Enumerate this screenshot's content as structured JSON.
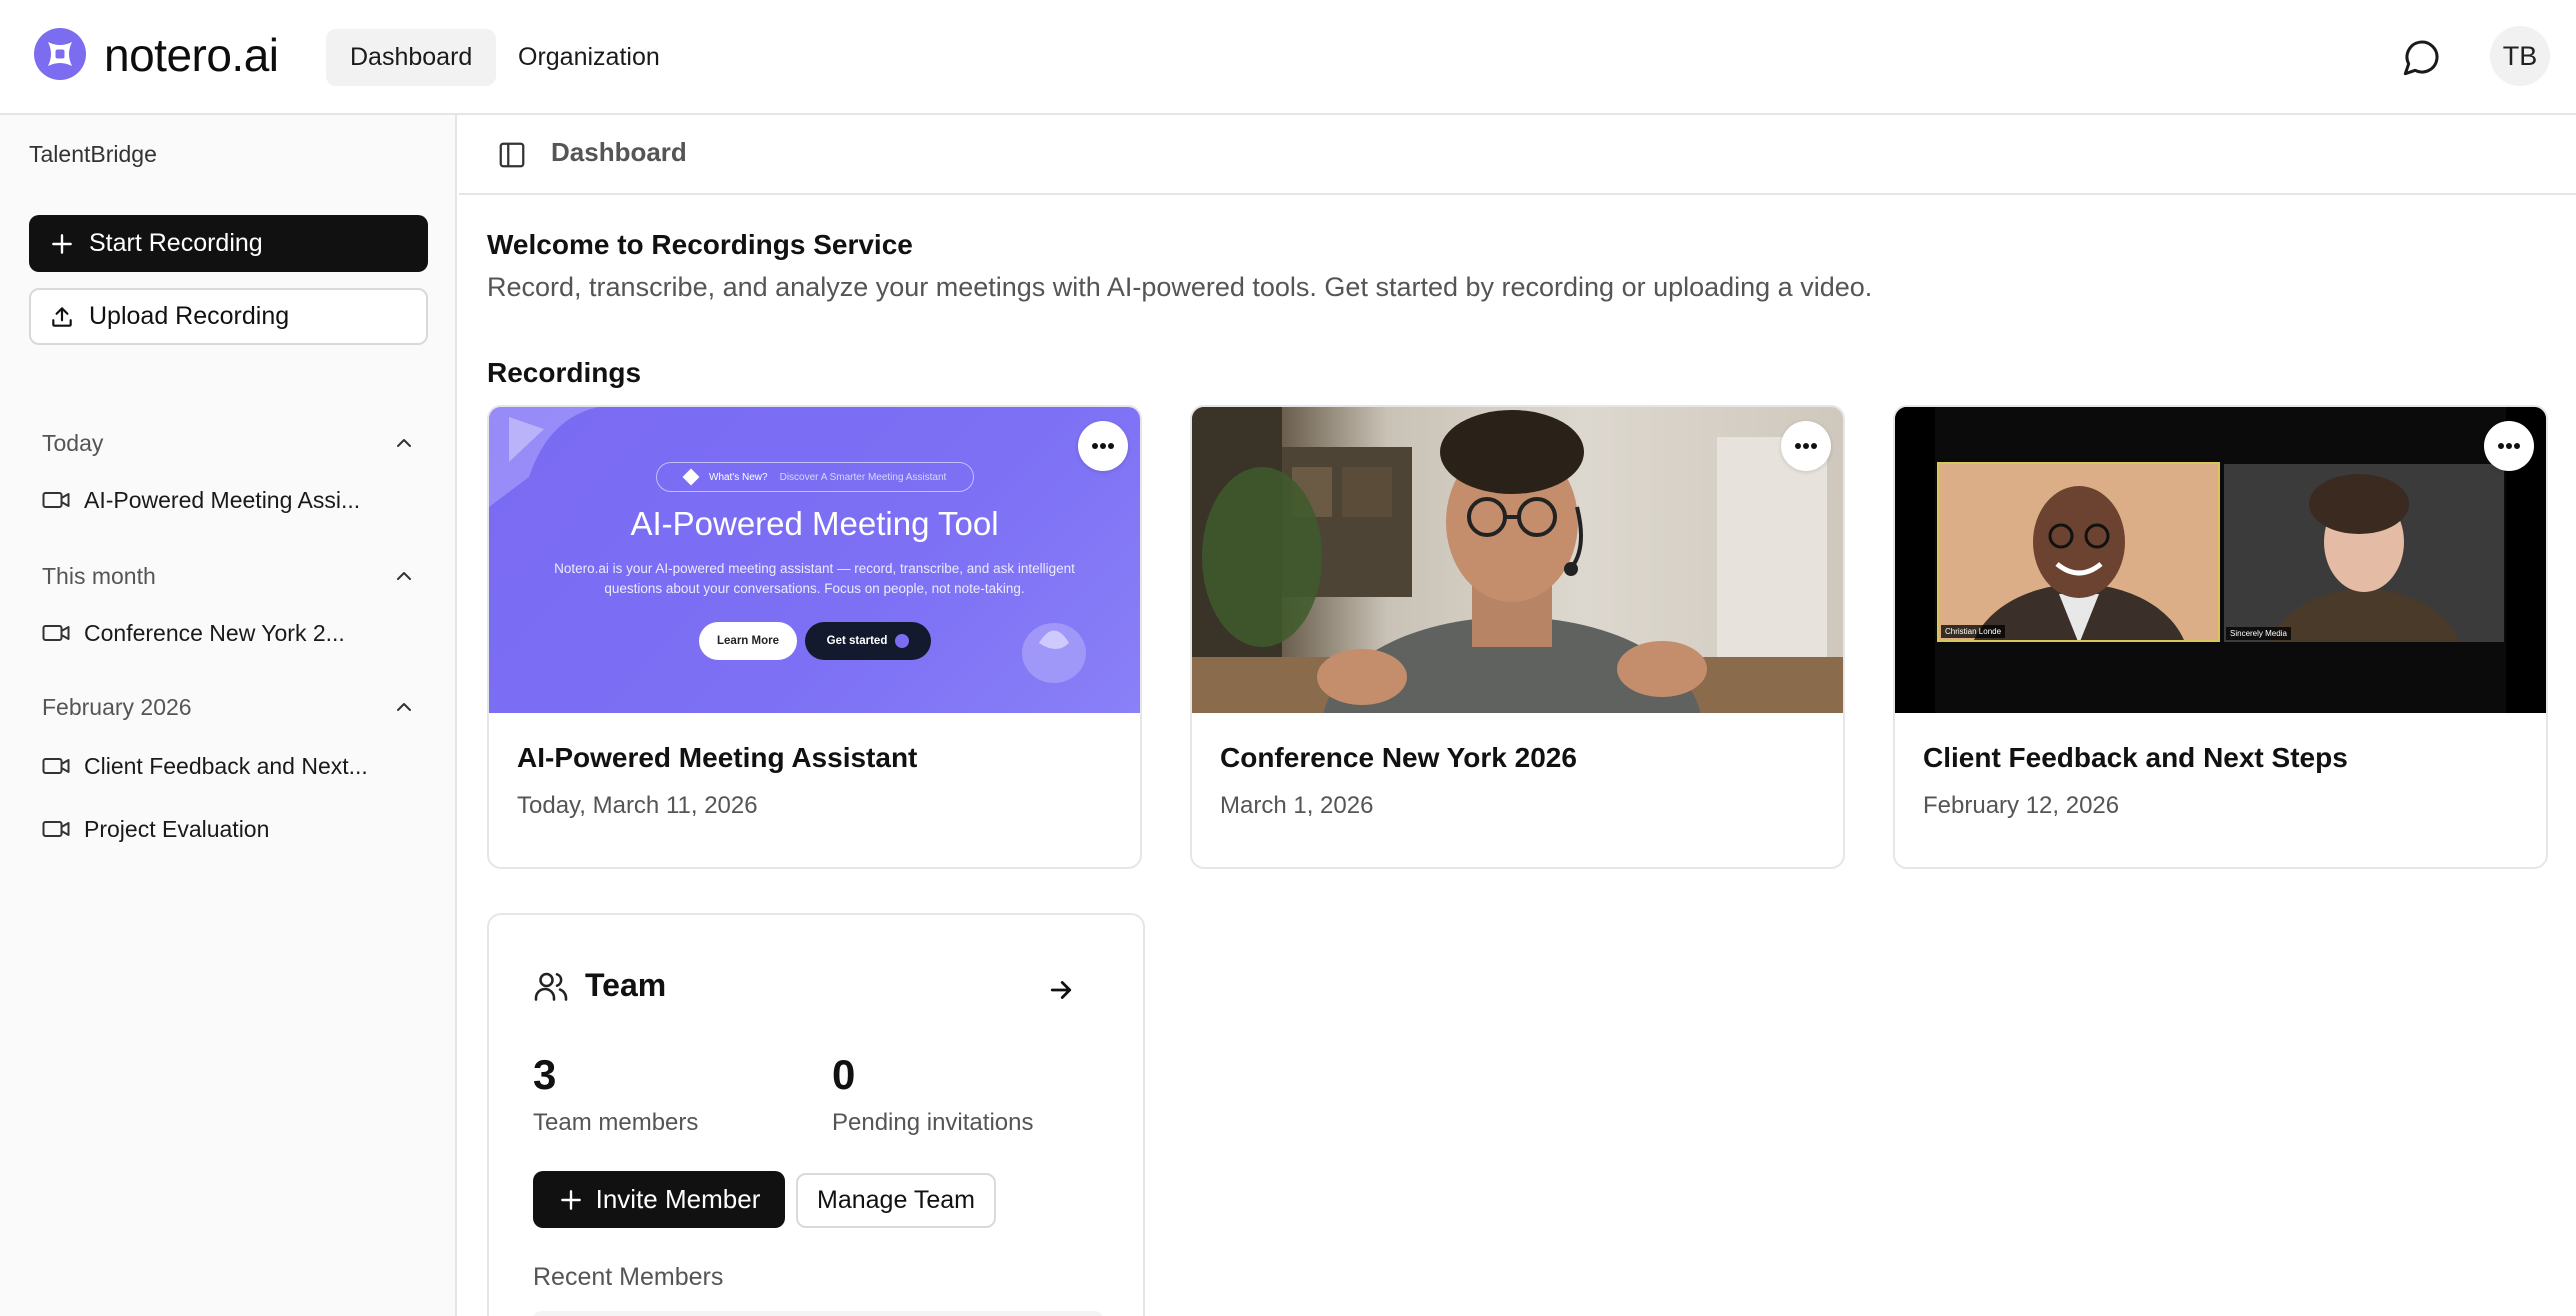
{
  "app": {
    "brand": "notero.ai",
    "brand_color": "#7b6cf0"
  },
  "topnav": {
    "tabs": [
      {
        "label": "Dashboard",
        "active": true
      },
      {
        "label": "Organization",
        "active": false
      }
    ],
    "user_initials": "TB",
    "chat_icon": "chat-bubble-icon"
  },
  "sidebar": {
    "org_name": "TalentBridge",
    "start_recording_label": "Start Recording",
    "upload_recording_label": "Upload Recording",
    "sections": [
      {
        "title": "Today",
        "items": [
          "AI-Powered Meeting Assi..."
        ]
      },
      {
        "title": "This month",
        "items": [
          "Conference New York 2..."
        ]
      },
      {
        "title": "February 2026",
        "items": [
          "Client Feedback and Next...",
          "Project Evaluation"
        ]
      }
    ]
  },
  "main": {
    "breadcrumb": "Dashboard",
    "welcome_title": "Welcome to Recordings Service",
    "welcome_subtitle": "Record, transcribe, and analyze your meetings with AI-powered tools. Get started by recording or uploading a video.",
    "recordings_title": "Recordings",
    "recordings": [
      {
        "title": "AI-Powered Meeting Assistant",
        "date": "Today, March 11, 2026",
        "thumbnail": {
          "pill_label": "What's New?",
          "pill_text": "Discover A Smarter Meeting Assistant",
          "heading": "AI-Powered Meeting Tool",
          "body": "Notero.ai is your AI-powered meeting assistant — record, transcribe, and ask intelligent questions about your conversations. Focus on people, not note-taking.",
          "button_1": "Learn More",
          "button_2": "Get started"
        }
      },
      {
        "title": "Conference New York 2026",
        "date": "March 1, 2026"
      },
      {
        "title": "Client Feedback and Next Steps",
        "date": "February 12, 2026",
        "thumbnail": {
          "tile_1_name": "Christian Londe",
          "tile_2_name": "Sincerely Media"
        }
      }
    ],
    "team": {
      "title": "Team",
      "members_count": "3",
      "members_label": "Team members",
      "pending_count": "0",
      "pending_label": "Pending invitations",
      "invite_label": "Invite Member",
      "manage_label": "Manage Team",
      "recent_label": "Recent Members"
    }
  }
}
